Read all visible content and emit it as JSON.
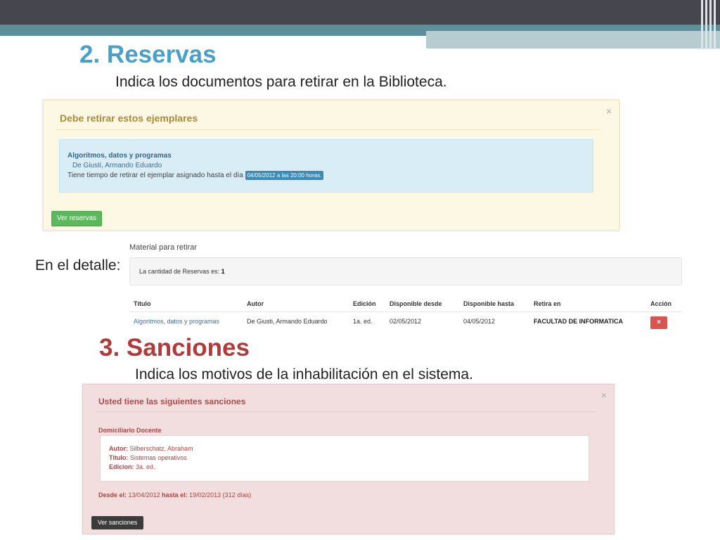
{
  "reservas": {
    "title": "2. Reservas",
    "subtitle": "Indica los documentos para retirar en la Biblioteca.",
    "alert": {
      "heading": "Debe retirar estos ejemplares",
      "close": "×",
      "book_title": "Algoritmos, datos y programas",
      "book_author": "De Giusti, Armando Eduardo",
      "due_text": "Tiene tiempo de retirar el ejemplar asignado hasta el día",
      "due_badge": "04/05/2012 a las 20:00 horas.",
      "button": "Ver reservas"
    }
  },
  "detalle": {
    "label": "En el detalle:",
    "heading": "Material para retirar",
    "count_text": "La cantidad de Reservas es:",
    "count_value": "1",
    "columns": [
      "Título",
      "Autor",
      "Edición",
      "Disponible desde",
      "Disponible hasta",
      "Retira en",
      "Acción"
    ],
    "rows": [
      {
        "titulo": "Algoritmos, datos y programas",
        "autor": "De Giusti, Armando Eduardo",
        "edicion": "1a. ed.",
        "desde": "02/05/2012",
        "hasta": "04/05/2012",
        "retira": "FACULTAD DE INFORMATICA",
        "accion": "×"
      }
    ]
  },
  "sanciones": {
    "title": "3. Sanciones",
    "subtitle": "Indica los motivos de la inhabilitación en el sistema.",
    "alert": {
      "heading": "Usted tiene las siguientes sanciones",
      "close": "×",
      "category": "Domiciliario Docente",
      "autor_label": "Autor:",
      "autor_value": "Silberschatz, Abraham",
      "titulo_label": "Titulo:",
      "titulo_value": "Sistemas operativos",
      "edicion_label": "Edicion:",
      "edicion_value": "3a. ed.",
      "desde_label": "Desde el:",
      "desde_value": "13/04/2012",
      "hasta_label": "hasta el:",
      "hasta_value": "19/02/2013 (312 días)",
      "button": "Ver sanciones"
    }
  },
  "colors": {
    "header_dark": "#46464f",
    "header_teal": "#5b8f99",
    "title_reservas": "#4aa0c8",
    "title_sanciones": "#b03b3b"
  }
}
